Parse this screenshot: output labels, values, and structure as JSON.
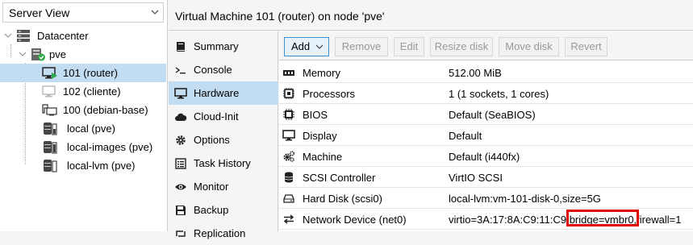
{
  "view_selector": {
    "value": "Server View"
  },
  "tree": {
    "datacenter": "Datacenter",
    "node": "pve",
    "items": [
      {
        "label": "101 (router)"
      },
      {
        "label": "102 (cliente)"
      },
      {
        "label": "100 (debian-base)"
      },
      {
        "label": "local (pve)"
      },
      {
        "label": "local-images (pve)"
      },
      {
        "label": "local-lvm (pve)"
      }
    ]
  },
  "header": {
    "title": "Virtual Machine 101 (router) on node 'pve'"
  },
  "nav": {
    "items": [
      {
        "label": "Summary",
        "icon": "book-icon"
      },
      {
        "label": "Console",
        "icon": "terminal-icon"
      },
      {
        "label": "Hardware",
        "icon": "monitor-icon"
      },
      {
        "label": "Cloud-Init",
        "icon": "cloud-icon"
      },
      {
        "label": "Options",
        "icon": "gear-icon"
      },
      {
        "label": "Task History",
        "icon": "list-icon"
      },
      {
        "label": "Monitor",
        "icon": "eye-icon"
      },
      {
        "label": "Backup",
        "icon": "floppy-icon"
      },
      {
        "label": "Replication",
        "icon": "retweet-icon"
      }
    ]
  },
  "toolbar": {
    "add": "Add",
    "remove": "Remove",
    "edit": "Edit",
    "resize_disk": "Resize disk",
    "move_disk": "Move disk",
    "revert": "Revert"
  },
  "hardware": {
    "rows": [
      {
        "key": "Memory",
        "value": "512.00 MiB",
        "icon": "memory-icon"
      },
      {
        "key": "Processors",
        "value": "1 (1 sockets, 1 cores)",
        "icon": "cpu-icon"
      },
      {
        "key": "BIOS",
        "value": "Default (SeaBIOS)",
        "icon": "chip-icon"
      },
      {
        "key": "Display",
        "value": "Default",
        "icon": "desktop-icon"
      },
      {
        "key": "Machine",
        "value": "Default (i440fx)",
        "icon": "cogs-icon"
      },
      {
        "key": "SCSI Controller",
        "value": "VirtIO SCSI",
        "icon": "database-icon"
      },
      {
        "key": "Hard Disk (scsi0)",
        "value": "local-lvm:vm-101-disk-0,size=5G",
        "icon": "hdd-icon"
      },
      {
        "key": "Network Device (net0)",
        "value": "virtio=3A:17:8A:C9:11:C9,bridge=vmbr0,firewall=1",
        "icon": "exchange-icon"
      }
    ]
  },
  "colors": {
    "selection": "#c2ddf2",
    "highlight_box": "#e00000",
    "running_status": "#2faa4a"
  }
}
